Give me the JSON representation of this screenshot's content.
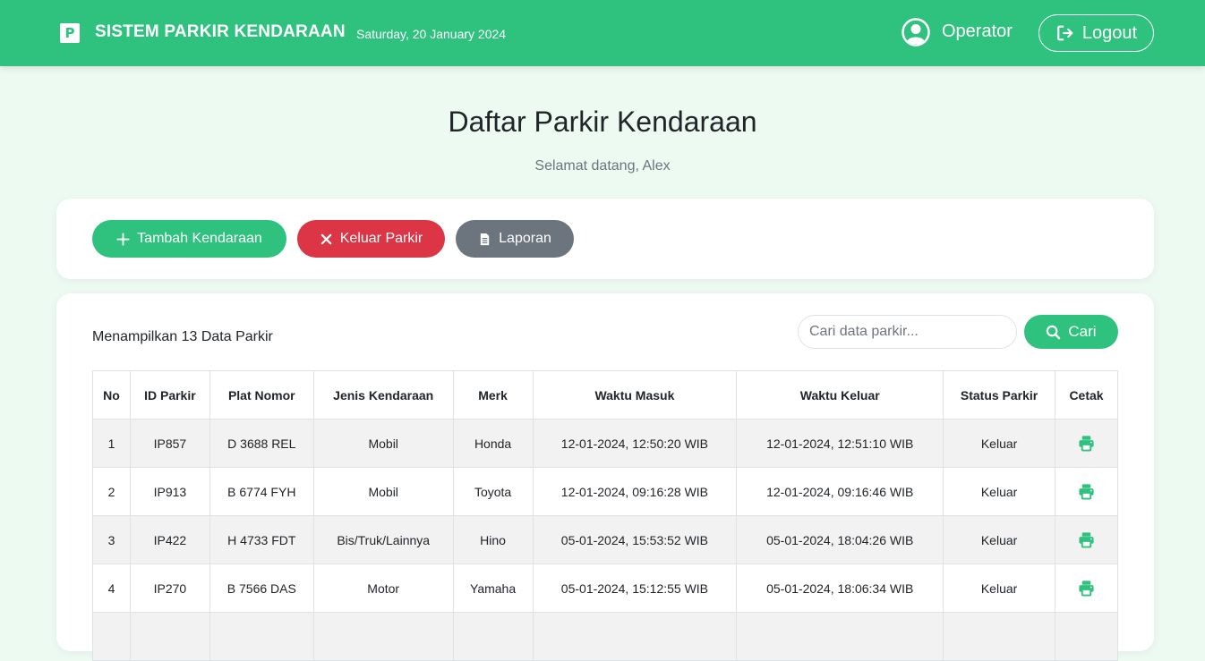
{
  "navbar": {
    "brand_letter": "P",
    "title": "SISTEM PARKIR KENDARAAN",
    "date": "Saturday, 20 January 2024",
    "user_label": "Operator",
    "logout_label": "Logout"
  },
  "header": {
    "title": "Daftar Parkir Kendaraan",
    "welcome": "Selamat datang, Alex"
  },
  "actions": {
    "add_label": "Tambah Kendaraan",
    "exit_label": "Keluar Parkir",
    "report_label": "Laporan"
  },
  "list": {
    "count_text": "Menampilkan 13 Data Parkir",
    "search_placeholder": "Cari data parkir...",
    "search_label": "Cari"
  },
  "table": {
    "columns": [
      "No",
      "ID Parkir",
      "Plat Nomor",
      "Jenis Kendaraan",
      "Merk",
      "Waktu Masuk",
      "Waktu Keluar",
      "Status Parkir",
      "Cetak"
    ],
    "rows": [
      {
        "no": "1",
        "id": "IP857",
        "plat": "D 3688 REL",
        "jenis": "Mobil",
        "merk": "Honda",
        "masuk": "12-01-2024, 12:50:20 WIB",
        "keluar": "12-01-2024, 12:51:10 WIB",
        "status": "Keluar"
      },
      {
        "no": "2",
        "id": "IP913",
        "plat": "B 6774 FYH",
        "jenis": "Mobil",
        "merk": "Toyota",
        "masuk": "12-01-2024, 09:16:28 WIB",
        "keluar": "12-01-2024, 09:16:46 WIB",
        "status": "Keluar"
      },
      {
        "no": "3",
        "id": "IP422",
        "plat": "H 4733 FDT",
        "jenis": "Bis/Truk/Lainnya",
        "merk": "Hino",
        "masuk": "05-01-2024, 15:53:52 WIB",
        "keluar": "05-01-2024, 18:04:26 WIB",
        "status": "Keluar"
      },
      {
        "no": "4",
        "id": "IP270",
        "plat": "B 7566 DAS",
        "jenis": "Motor",
        "merk": "Yamaha",
        "masuk": "05-01-2024, 15:12:55 WIB",
        "keluar": "05-01-2024, 18:06:34 WIB",
        "status": "Keluar"
      },
      {
        "no": "",
        "id": "",
        "plat": "",
        "jenis": "",
        "merk": "",
        "masuk": "",
        "keluar": "",
        "status": ""
      }
    ]
  },
  "colors": {
    "primary": "#2ec27e",
    "danger": "#dc3545",
    "secondary": "#6c757d",
    "background": "#ecfaf2"
  },
  "icons": {
    "brand": "parking-icon",
    "user": "user-circle-icon",
    "logout": "logout-icon",
    "add": "plus-icon",
    "exit": "close-icon",
    "report": "document-icon",
    "search": "search-icon",
    "print": "printer-icon"
  }
}
